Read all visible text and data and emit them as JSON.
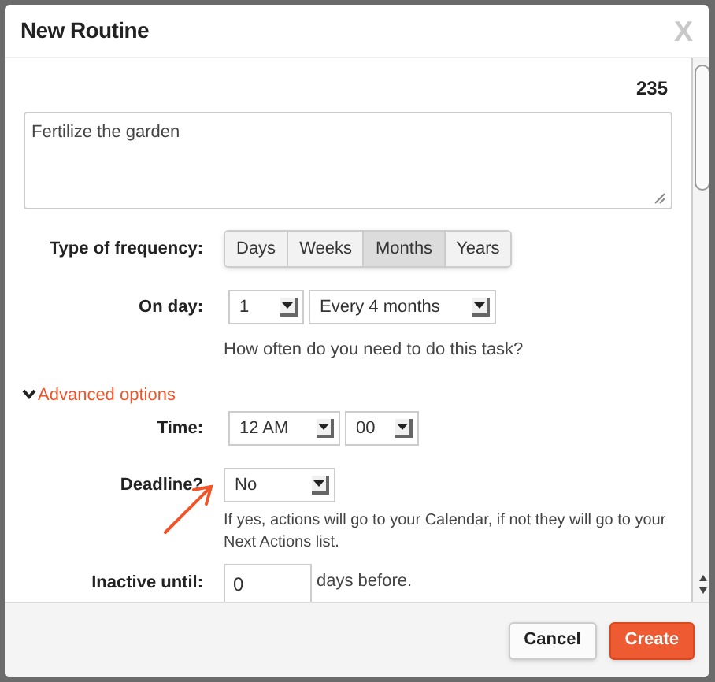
{
  "window": {
    "title": "New Routine",
    "close": "X"
  },
  "char_count": "235",
  "description": {
    "value": "Fertilize the garden"
  },
  "frequency": {
    "label": "Type of frequency:",
    "options": [
      {
        "label": "Days",
        "selected": false
      },
      {
        "label": "Weeks",
        "selected": false
      },
      {
        "label": "Months",
        "selected": true
      },
      {
        "label": "Years",
        "selected": false
      }
    ]
  },
  "on_day": {
    "label": "On day:",
    "day": "1",
    "interval": "Every 4 months",
    "hint": "How often do you need to do this task?"
  },
  "advanced": {
    "label": "Advanced options",
    "expanded": true
  },
  "time": {
    "label": "Time:",
    "hour": "12 AM",
    "minute": "00"
  },
  "deadline": {
    "label": "Deadline?",
    "value": "No",
    "hint": "If yes, actions will go to your Calendar, if not they will go to your Next Actions list."
  },
  "inactive": {
    "label": "Inactive until:",
    "value": "0",
    "suffix": "days before."
  },
  "buttons": [
    {
      "kind": "secondary",
      "label": "Cancel"
    },
    {
      "kind": "primary",
      "label": "Create"
    }
  ]
}
